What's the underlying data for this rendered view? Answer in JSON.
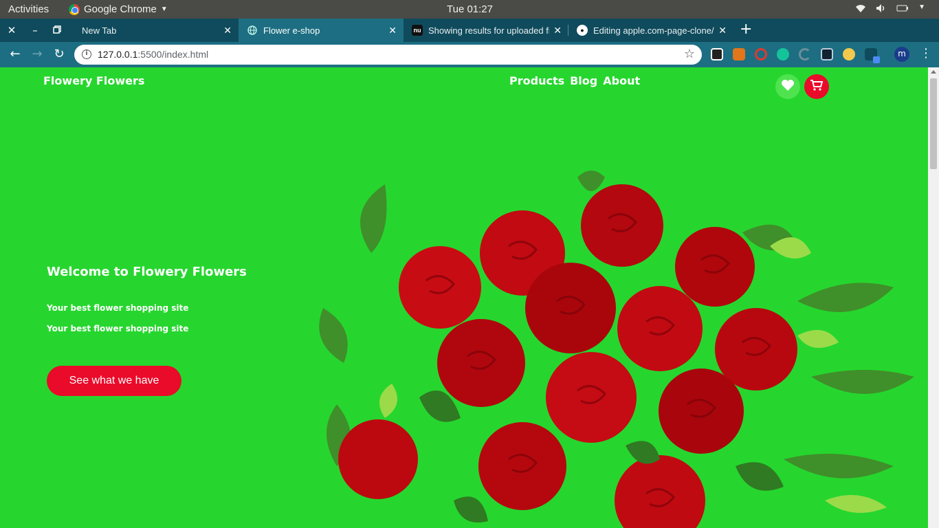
{
  "system": {
    "activities": "Activities",
    "app_name": "Google Chrome",
    "clock": "Tue 01:27"
  },
  "tabs": [
    {
      "title": "New Tab",
      "active": false
    },
    {
      "title": "Flower e-shop",
      "active": true
    },
    {
      "title": "Showing results for uploaded fil",
      "active": false
    },
    {
      "title": "Editing apple.com-page-clone/",
      "active": false
    }
  ],
  "toolbar": {
    "url_host": "127.0.0.1",
    "url_path": ":5500/index.html",
    "profile_initial": "m"
  },
  "page": {
    "brand": "Flowery Flowers",
    "nav": [
      "Products",
      "Blog",
      "About"
    ],
    "hero_title": "Welcome to Flowery Flowers",
    "hero_subtitles": [
      "Your best flower shopping site",
      "Your best flower shopping site"
    ],
    "cta_label": "See what we have"
  },
  "colors": {
    "page_bg": "#26d62e",
    "accent_red": "#ea0a2a",
    "favorite_green": "#4fe34f",
    "tab_bar": "#0f4b5c",
    "toolbar": "#1d6e82"
  },
  "icons": [
    "heart-icon",
    "cart-icon",
    "star-icon",
    "info-icon",
    "back-arrow-icon",
    "forward-arrow-icon",
    "reload-icon"
  ]
}
